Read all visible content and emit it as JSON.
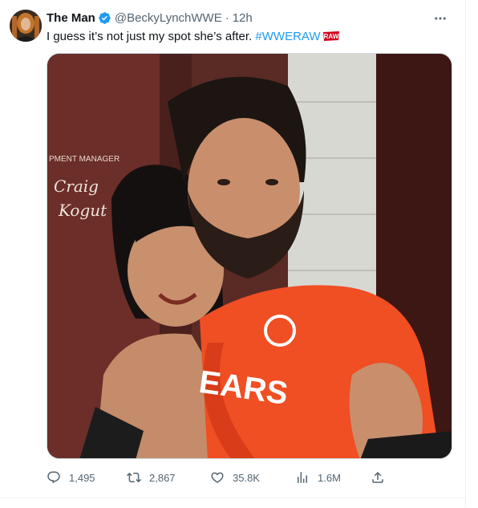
{
  "tweet": {
    "display_name": "The Man",
    "handle": "@BeckyLynchWWE",
    "separator": "·",
    "time": "12h",
    "text": "I guess it’s not just my spot she’s after. ",
    "hashtag": "#WWERAW",
    "raw_logo_text": "RAW",
    "media_sign_line1": "PMENT MANAGER",
    "media_sign_line2": "Craig",
    "media_sign_line3": "Kogut",
    "media_shirt_text": "EARS"
  },
  "actions": {
    "replies": "1,495",
    "retweets": "2,867",
    "likes": "35.8K",
    "views": "1.6M"
  },
  "icons": [
    "verified-icon",
    "more-icon",
    "reply-icon",
    "retweet-icon",
    "like-icon",
    "views-icon",
    "share-icon"
  ],
  "colors": {
    "accent": "#1d9bf0",
    "text": "#0f1419",
    "secondary": "#536471",
    "raw_red": "#d0021b"
  }
}
